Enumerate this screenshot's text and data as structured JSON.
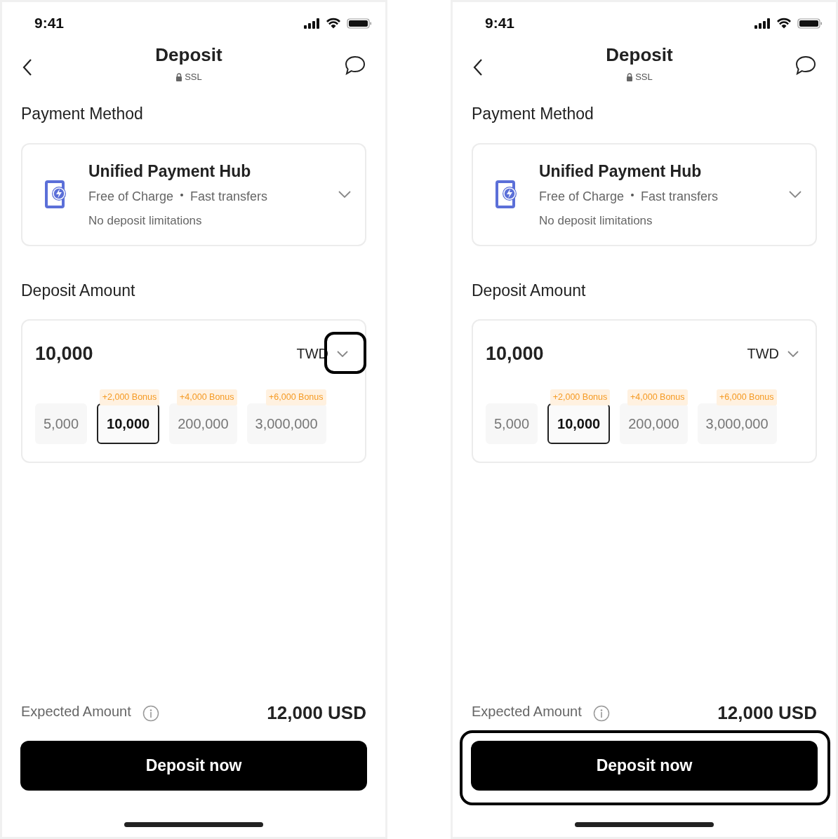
{
  "screens": [
    {
      "currency_highlighted": true,
      "button_highlighted": false,
      "status_bar": {
        "time": "9:41"
      },
      "header": {
        "title": "Deposit",
        "security": "SSL"
      },
      "payment_section": {
        "title": "Payment Method",
        "method": {
          "name": "Unified Payment Hub",
          "feature_1": "Free of Charge",
          "feature_2": "Fast transfers",
          "note": "No deposit limitations"
        }
      },
      "amount_section": {
        "title": "Deposit Amount",
        "amount": "10,000",
        "currency": "TWD",
        "options": [
          {
            "amount": "5,000",
            "selected": false
          },
          {
            "amount": "10,000",
            "selected": true,
            "bonus": "+2,000 Bonus"
          },
          {
            "amount": "200,000",
            "selected": false,
            "bonus": "+4,000 Bonus"
          },
          {
            "amount": "3,000,000",
            "selected": false,
            "bonus": "+6,000 Bonus"
          }
        ]
      },
      "expected": {
        "label": "Expected Amount",
        "value": "12,000 USD"
      },
      "button": "Deposit now"
    },
    {
      "currency_highlighted": false,
      "button_highlighted": true,
      "status_bar": {
        "time": "9:41"
      },
      "header": {
        "title": "Deposit",
        "security": "SSL"
      },
      "payment_section": {
        "title": "Payment Method",
        "method": {
          "name": "Unified Payment Hub",
          "feature_1": "Free of Charge",
          "feature_2": "Fast transfers",
          "note": "No deposit limitations"
        }
      },
      "amount_section": {
        "title": "Deposit Amount",
        "amount": "10,000",
        "currency": "TWD",
        "options": [
          {
            "amount": "5,000",
            "selected": false
          },
          {
            "amount": "10,000",
            "selected": true,
            "bonus": "+2,000 Bonus"
          },
          {
            "amount": "200,000",
            "selected": false,
            "bonus": "+4,000 Bonus"
          },
          {
            "amount": "3,000,000",
            "selected": false,
            "bonus": "+6,000 Bonus"
          }
        ]
      },
      "expected": {
        "label": "Expected Amount",
        "value": "12,000 USD"
      },
      "button": "Deposit now"
    }
  ]
}
